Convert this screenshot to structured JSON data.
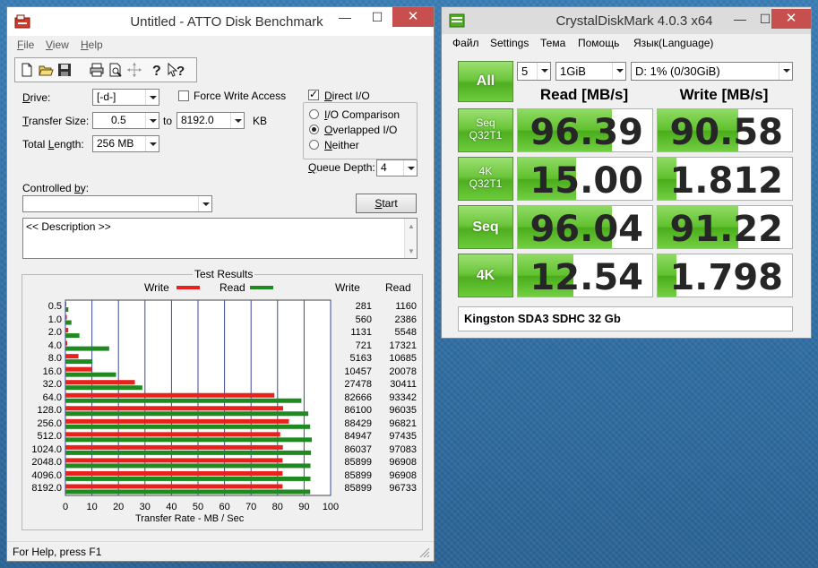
{
  "atto": {
    "title": "Untitled - ATTO Disk Benchmark",
    "window_buttons": {
      "minimize": "—",
      "maximize": "☐",
      "close": "✕"
    },
    "menu": [
      {
        "hot": "F",
        "rest": "ile"
      },
      {
        "hot": "V",
        "rest": "iew"
      },
      {
        "hot": "H",
        "rest": "elp"
      }
    ],
    "toolbar_icons": [
      "new-icon",
      "open-icon",
      "save-icon",
      "print-icon",
      "print-preview-icon",
      "move-icon",
      "help-icon",
      "context-help-icon"
    ],
    "drive_label_hot": "D",
    "drive_label_rest": "rive:",
    "drive_value": "[-d-]",
    "force_write_label": "Force Write Access",
    "transfer_size_label_hot": "T",
    "transfer_size_label_rest": "ransfer Size:",
    "transfer_from": "0.5",
    "to_label": "to",
    "transfer_to": "8192.0",
    "kb_label": "KB",
    "total_length_label_pre": "Total ",
    "total_length_label_hot": "L",
    "total_length_label_rest": "ength:",
    "total_length_value": "256 MB",
    "direct_io_label_hot": "D",
    "direct_io_label_rest": "irect I/O",
    "direct_io_checked": true,
    "io_mode_options": [
      {
        "hot": "I",
        "rest": "/O Comparison",
        "selected": false
      },
      {
        "hot": "O",
        "rest": "verlapped I/O",
        "selected": true
      },
      {
        "hot": "N",
        "rest": "either",
        "selected": false
      }
    ],
    "queue_depth_label_hot": "Q",
    "queue_depth_label_rest": "ueue Depth:",
    "queue_depth_value": "4",
    "controlled_by_label_pre": "Controlled ",
    "controlled_by_label_hot": "b",
    "controlled_by_label_rest": "y:",
    "controlled_by_value": "",
    "start_label_hot": "S",
    "start_label_rest": "tart",
    "description": "<< Description >>",
    "results_title": "Test Results",
    "legend_write": "Write",
    "legend_read": "Read",
    "col_write": "Write",
    "col_read": "Read",
    "status": "For Help, press F1",
    "colors": {
      "write": "#e8211d",
      "read": "#1f8a1f"
    }
  },
  "chart_data": {
    "type": "bar",
    "title": "Test Results",
    "xlabel": "Transfer Rate - MB / Sec",
    "xlim": [
      0,
      100
    ],
    "x_ticks": [
      "0",
      "10",
      "20",
      "30",
      "40",
      "50",
      "60",
      "70",
      "80",
      "90",
      "100"
    ],
    "categories": [
      "0.5",
      "1.0",
      "2.0",
      "4.0",
      "8.0",
      "16.0",
      "32.0",
      "64.0",
      "128.0",
      "256.0",
      "512.0",
      "1024.0",
      "2048.0",
      "4096.0",
      "8192.0"
    ],
    "series": [
      {
        "name": "Write",
        "values": [
          0.27,
          0.53,
          1.08,
          0.69,
          4.92,
          9.97,
          26.2,
          78.8,
          82.1,
          84.3,
          81.0,
          82.0,
          81.9,
          81.9,
          81.9
        ],
        "labels": [
          "281",
          "560",
          "1131",
          "721",
          "5163",
          "10457",
          "27478",
          "82666",
          "86100",
          "88429",
          "84947",
          "86037",
          "85899",
          "85899",
          "85899"
        ]
      },
      {
        "name": "Read",
        "values": [
          1.11,
          2.28,
          5.29,
          16.5,
          10.2,
          19.1,
          29.0,
          89.0,
          91.6,
          92.3,
          92.9,
          92.6,
          92.4,
          92.4,
          92.3
        ],
        "labels": [
          "1160",
          "2386",
          "5548",
          "17321",
          "10685",
          "20078",
          "30411",
          "93342",
          "96035",
          "96821",
          "97435",
          "97083",
          "96908",
          "96908",
          "96733"
        ]
      }
    ],
    "legend": "top"
  },
  "cdm": {
    "title": "CrystalDiskMark 4.0.3 x64",
    "window_buttons": {
      "minimize": "—",
      "maximize": "☐",
      "close": "✕"
    },
    "menu": [
      "Файл",
      "Settings",
      "Тема",
      "Помощь",
      "Язык(Language)"
    ],
    "all_label": "All",
    "count_value": "5",
    "size_value": "1GiB",
    "drive_value": "D: 1% (0/30GiB)",
    "read_header": "Read [MB/s]",
    "write_header": "Write [MB/s]",
    "rows": [
      {
        "line1": "Seq",
        "line2": "Q32T1",
        "read": "96.39",
        "write": "90.58",
        "read_fill": 0.7,
        "write_fill": 0.6
      },
      {
        "line1": "4K",
        "line2": "Q32T1",
        "read": "15.00",
        "write": "1.812",
        "read_fill": 0.43,
        "write_fill": 0.14
      },
      {
        "line1": "Seq",
        "line2": "",
        "read": "96.04",
        "write": "91.22",
        "read_fill": 0.7,
        "write_fill": 0.6
      },
      {
        "line1": "4K",
        "line2": "",
        "read": "12.54",
        "write": "1.798",
        "read_fill": 0.41,
        "write_fill": 0.14
      }
    ],
    "comment": "Kingston SDA3 SDHC 32 Gb",
    "colors": {
      "accent": "#5fc02d"
    }
  }
}
